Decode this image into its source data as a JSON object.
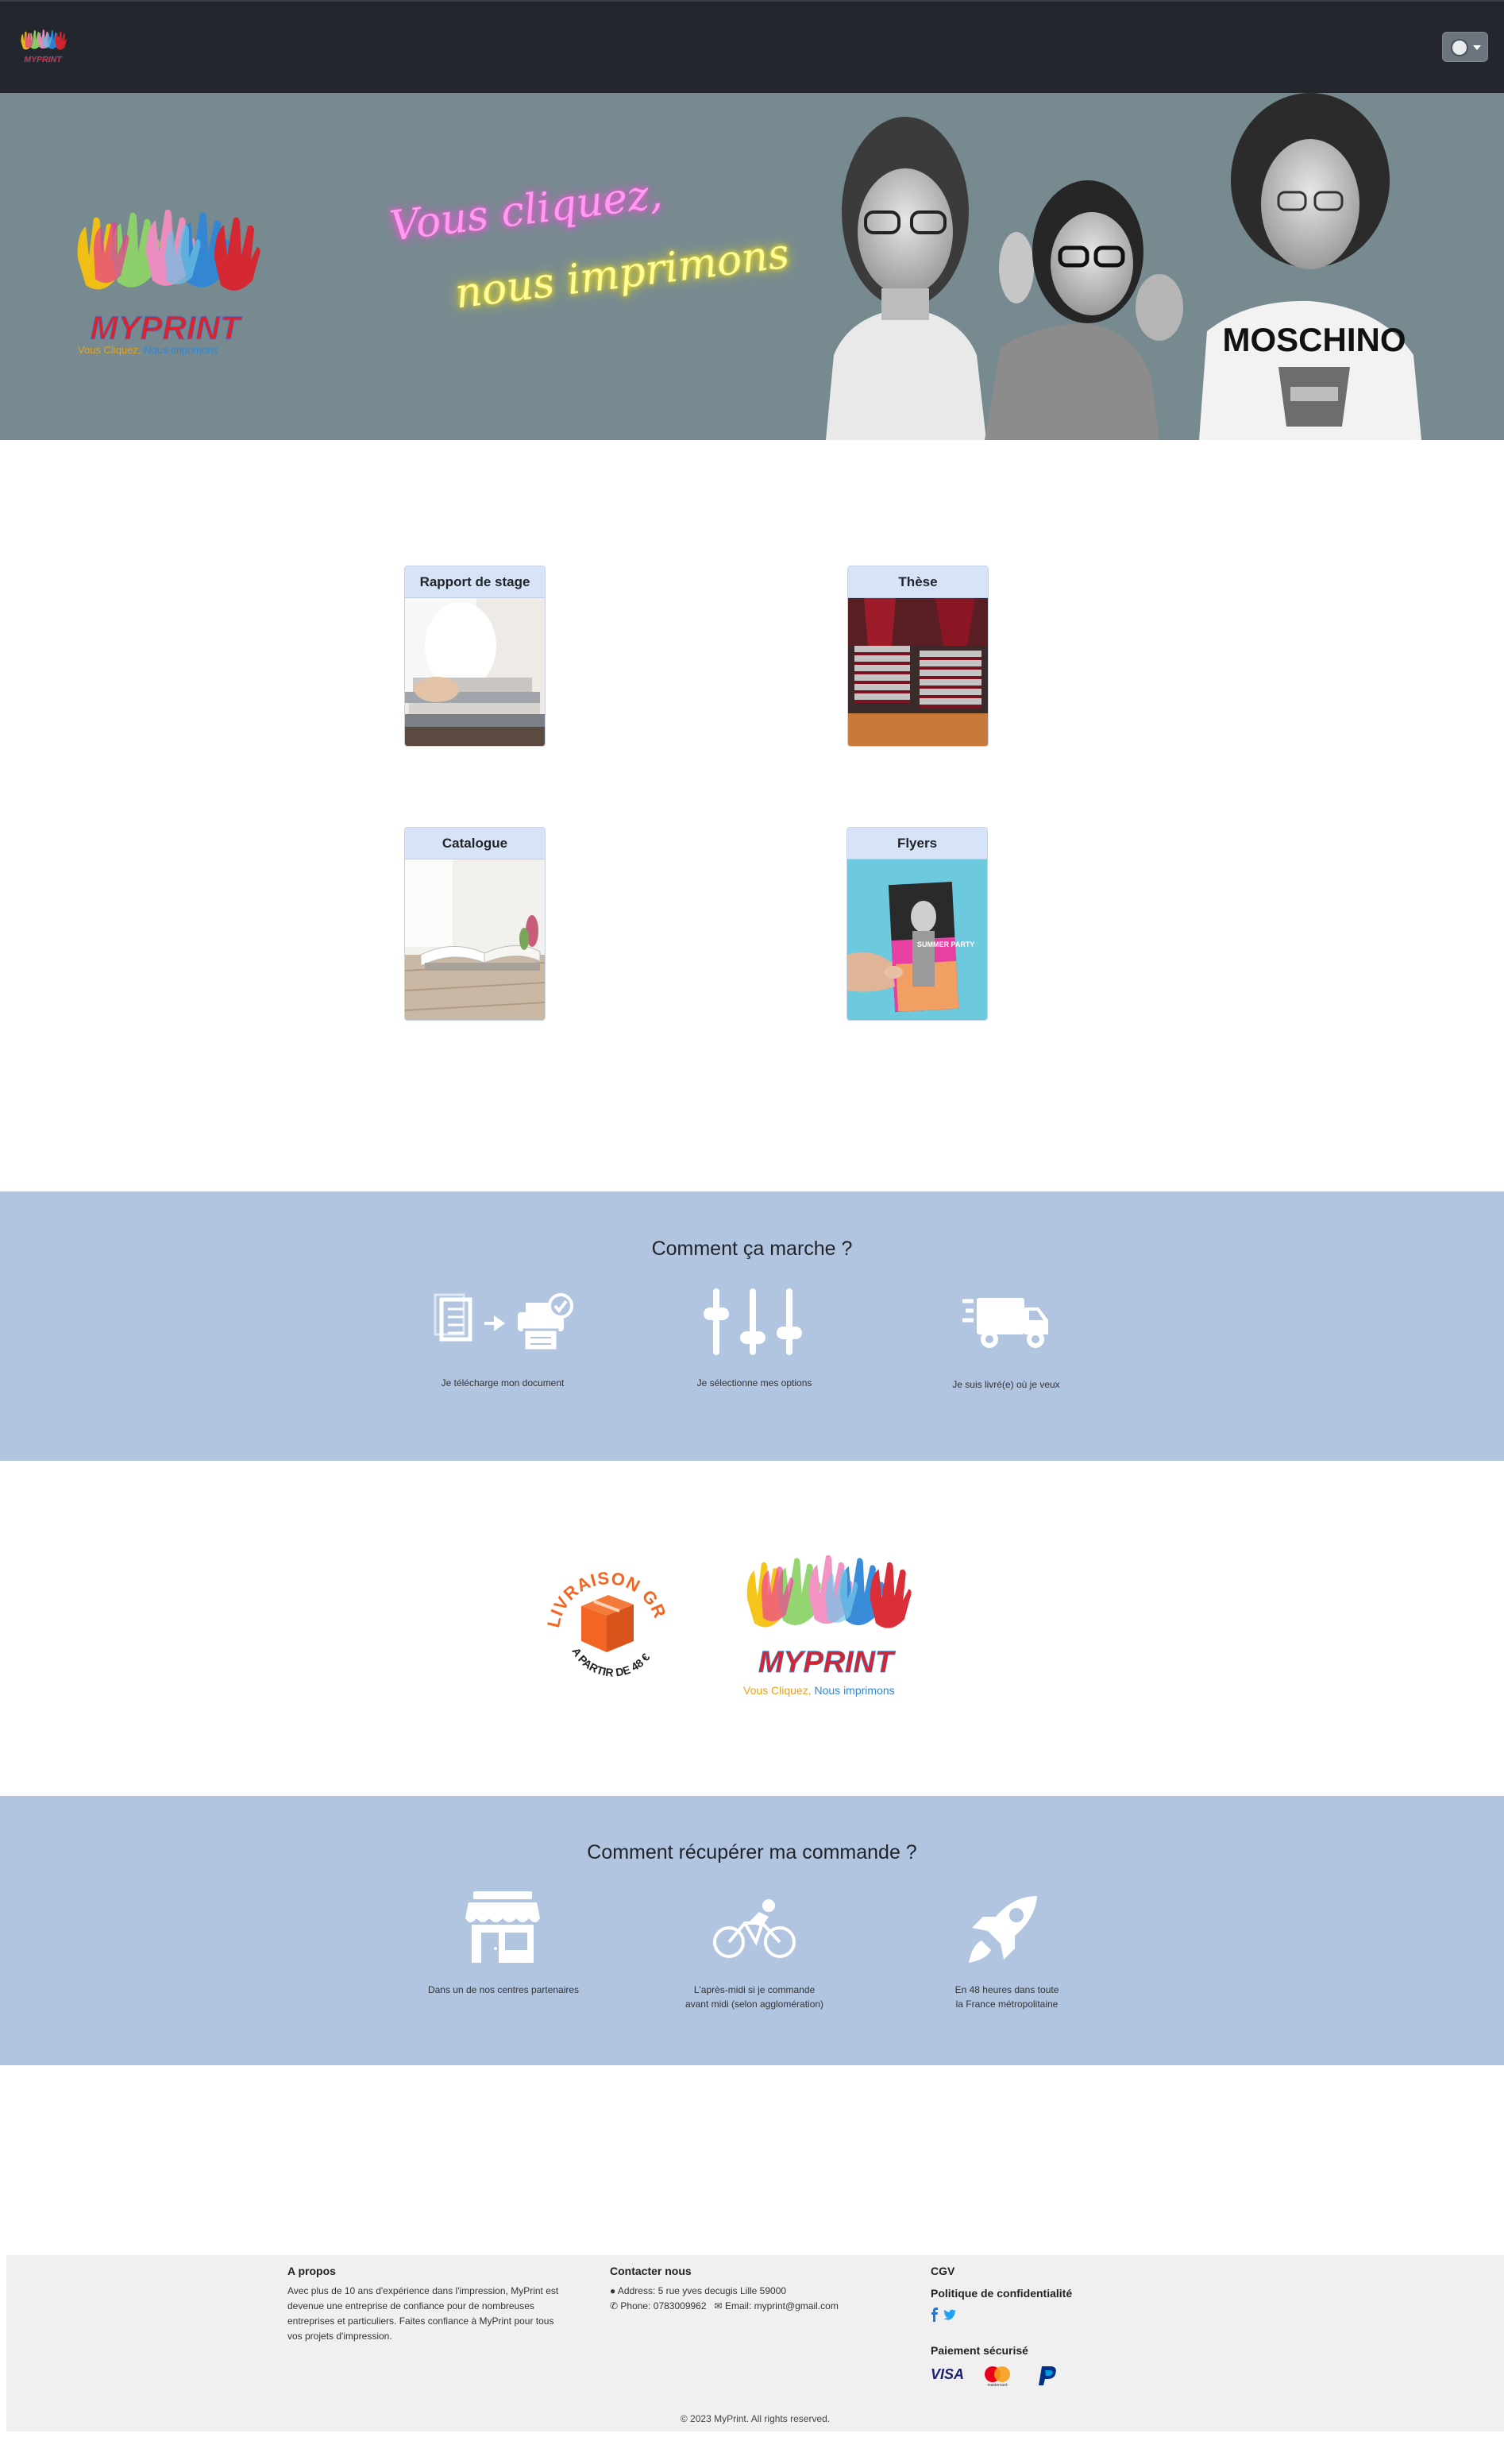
{
  "brand": {
    "name": "MyPrint",
    "tagline": "Vous Cliquez, Nous imprimons",
    "logo_letters": "MYPRINT"
  },
  "navbar": {
    "user_icon": "user-avatar-icon"
  },
  "hero": {
    "slogan_line1": "Vous cliquez,",
    "slogan_line2": "nous imprimons",
    "shirt_text": "MOSCHINO"
  },
  "products": [
    {
      "title": "Rapport de stage"
    },
    {
      "title": "Thèse"
    },
    {
      "title": "Catalogue"
    },
    {
      "title": "Flyers",
      "flyer_text": "SUMMER PARTY"
    }
  ],
  "how_it_works": {
    "title": "Comment ça marche ?",
    "steps": [
      {
        "label": "Je télécharge mon document",
        "icon": "document-to-printer-icon"
      },
      {
        "label": "Je sélectionne mes options",
        "icon": "sliders-icon"
      },
      {
        "label": "Je suis livré(e) où je veux",
        "icon": "delivery-truck-icon"
      }
    ]
  },
  "badge": {
    "line1": "LIVRAISON GRATUITE",
    "line2": "A PARTIR DE 48 €"
  },
  "pickup": {
    "title": "Comment récupérer ma commande ?",
    "options": [
      {
        "line1": "Dans un de nos centres partenaires",
        "line2": "",
        "icon": "store-icon"
      },
      {
        "line1": "L'après-midi si je commande",
        "line2": "avant midi (selon agglomération)",
        "icon": "bicycle-icon"
      },
      {
        "line1": "En 48 heures dans toute",
        "line2": "la France métropolitaine",
        "icon": "rocket-icon"
      }
    ]
  },
  "footer": {
    "about_title": "A propos",
    "about_lines": [
      "Avec plus de 10 ans d'expérience dans l'impression, MyPrint est",
      "devenue une entreprise de confiance pour de nombreuses",
      "entreprises et particuliers. Faites confiance à MyPrint pour tous",
      "vos projets d'impression."
    ],
    "contact_title": "Contacter nous",
    "address": "Address: 5 rue yves decugis Lille 59000",
    "phone": "Phone: 0783009962",
    "email": "Email: myprint@gmail.com",
    "cgv": "CGV",
    "privacy": "Politique de confidentialité",
    "payment_title": "Paiement sécurisé",
    "payment_methods": [
      "VISA",
      "mastercard",
      "PayPal"
    ],
    "copyright": "© 2023 MyPrint. All rights reserved.",
    "colors": {
      "facebook": "#1877f2",
      "twitter": "#1da1f2"
    }
  },
  "colors": {
    "navbar": "#23262c",
    "hero": "#778a90",
    "band": "#b1c4e0",
    "card_header": "#d7e3f6",
    "badge_orange": "#f26522"
  }
}
